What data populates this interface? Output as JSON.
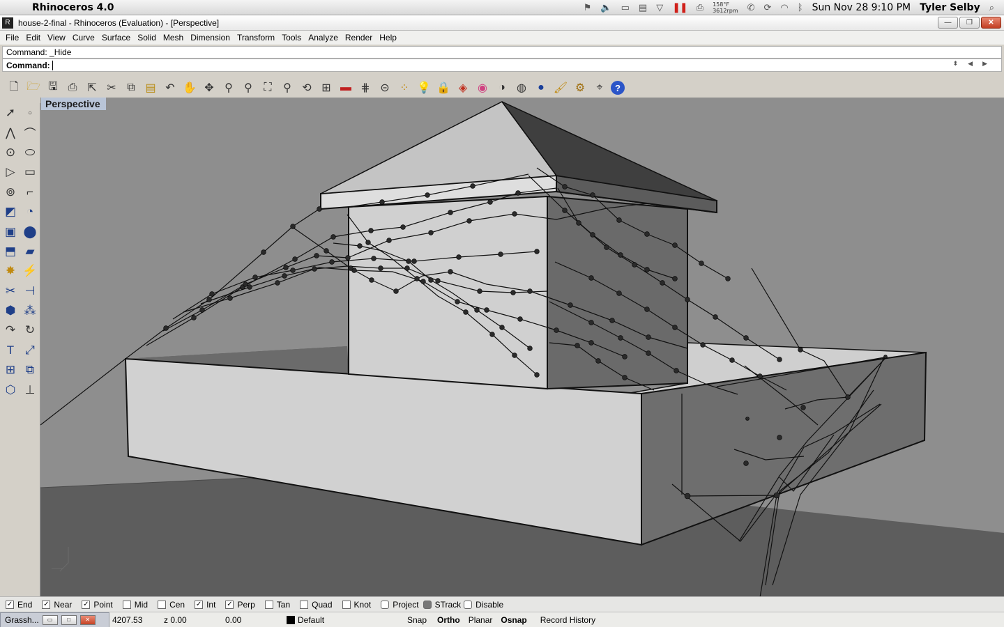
{
  "mac_menubar": {
    "apple_glyph": "",
    "app_name": "Rhinoceros 4.0",
    "temperature": "158°F",
    "fan_speed": "3612rpm",
    "datetime": "Sun Nov 28  9:10 PM",
    "user": "Tyler Selby",
    "icons": [
      "flag-icon",
      "volume-icon",
      "display-icon",
      "clipboard-icon",
      "dropdown-icon",
      "pause-icon",
      "printer-icon",
      "phone-icon",
      "sync-icon",
      "wifi-icon",
      "bluetooth-icon",
      "spotlight-icon"
    ]
  },
  "window": {
    "title": "house-2-final - Rhinoceros (Evaluation) - [Perspective]",
    "buttons": [
      "minimize",
      "restore",
      "close"
    ]
  },
  "menu": [
    "File",
    "Edit",
    "View",
    "Curve",
    "Surface",
    "Solid",
    "Mesh",
    "Dimension",
    "Transform",
    "Tools",
    "Analyze",
    "Render",
    "Help"
  ],
  "command": {
    "history": "Command: _Hide",
    "prompt": "Command:",
    "value": ""
  },
  "toolbar_icons": [
    "new-icon",
    "open-icon",
    "save-icon",
    "print-icon",
    "export-icon",
    "cut-icon",
    "copy-icon",
    "paste-icon",
    "undo-icon",
    "pan-icon",
    "rotate-icon",
    "zoom-icon",
    "zoom-window-icon",
    "zoom-extents-icon",
    "zoom-selected-icon",
    "rotate-view-icon",
    "four-viewports-icon",
    "car-icon",
    "grid-icon",
    "cplane-icon",
    "points-icon",
    "light-icon",
    "lock-icon",
    "layer-icon",
    "color-wheel-icon",
    "shade-icon",
    "render-shade-icon",
    "render-sphere-icon",
    "brush-icon",
    "gear-icon",
    "gumball-icon",
    "help-icon"
  ],
  "viewport": {
    "title": "Perspective"
  },
  "osnaps": [
    {
      "label": "End",
      "checked": true
    },
    {
      "label": "Near",
      "checked": true
    },
    {
      "label": "Point",
      "checked": true
    },
    {
      "label": "Mid",
      "checked": false
    },
    {
      "label": "Cen",
      "checked": false
    },
    {
      "label": "Int",
      "checked": true
    },
    {
      "label": "Perp",
      "checked": true
    },
    {
      "label": "Tan",
      "checked": false
    },
    {
      "label": "Quad",
      "checked": false
    },
    {
      "label": "Knot",
      "checked": false
    },
    {
      "label": "Project",
      "checked": false
    },
    {
      "label": "STrack",
      "checked": false
    },
    {
      "label": "Disable",
      "checked": false
    }
  ],
  "status": {
    "grasshopper_tab": "Grassh...",
    "x": "4207.53",
    "z_label": "z 0.00",
    "value": "0.00",
    "layer": "Default",
    "snap": "Snap",
    "ortho": "Ortho",
    "planar": "Planar",
    "osnap": "Osnap",
    "record_history": "Record History"
  }
}
